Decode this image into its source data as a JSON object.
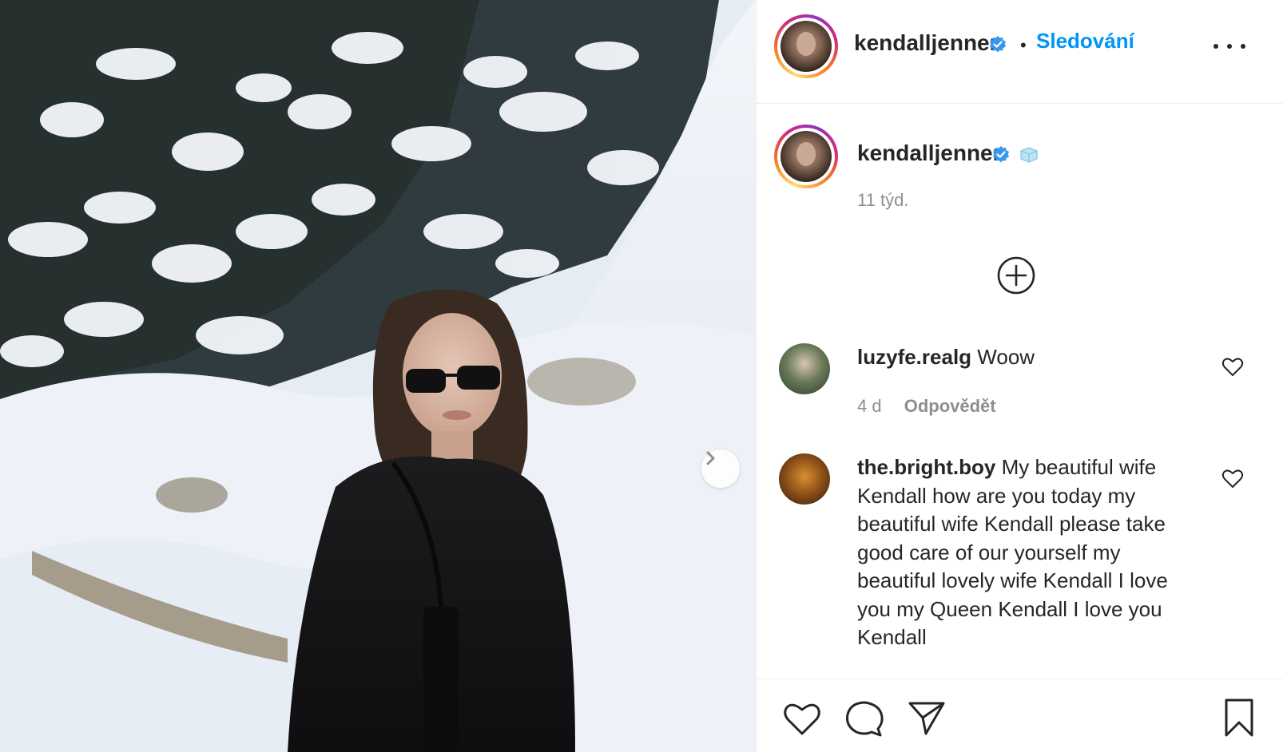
{
  "post": {
    "image_alt": "Woman in dark coat and sunglasses in snowy forest",
    "carousel_next_icon": "chevron-right-icon"
  },
  "header": {
    "username": "kendalljenner",
    "verified_icon": "verified-badge-icon",
    "separator": "•",
    "follow_label": "Sledování",
    "more_icon": "more-dots-icon"
  },
  "caption": {
    "username": "kendalljenner",
    "emoji_icon": "ice-cube-emoji-icon",
    "time": "11 týd."
  },
  "add_icon": "plus-circle-icon",
  "comments": [
    {
      "username": "luzyfe.realg",
      "text": "Woow",
      "time": "4 d",
      "reply_label": "Odpovědět"
    },
    {
      "username": "the.bright.boy",
      "text": "My beautiful wife Kendall how are you today my beautiful wife Kendall please take good care of our yourself my beautiful lovely wife Kendall I love you my Queen Kendall I love you Kendall"
    }
  ],
  "actions": {
    "like_icon": "heart-icon",
    "comment_icon": "comment-icon",
    "share_icon": "paper-plane-icon",
    "save_icon": "bookmark-icon"
  },
  "colors": {
    "link_blue": "#0095f6",
    "text": "#262626",
    "muted": "#8e8e8e",
    "verified": "#3897f0"
  }
}
